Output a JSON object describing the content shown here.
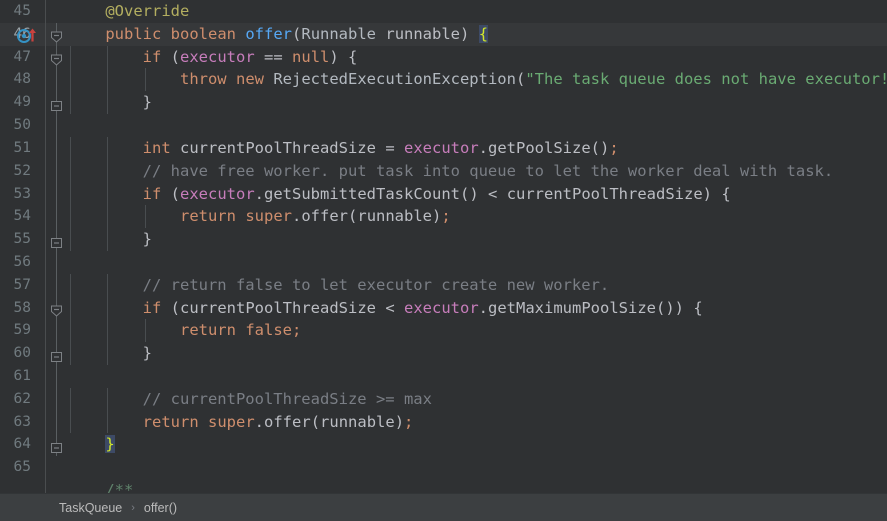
{
  "app": {
    "kind": "code-editor",
    "theme": "darcula",
    "background": "#2f3133",
    "current_line_background": "#36383a",
    "gutter_text_color": "#707a7f"
  },
  "colors": {
    "keyword": "#cf8e6d",
    "string": "#6aab73",
    "comment": "#7a7e85",
    "javadoc": "#5f826b",
    "annotation": "#b3ae60",
    "method": "#56a8f5",
    "field": "#c77dbb",
    "text": "#bcbec4",
    "brace_match_bg": "#3d4a66",
    "brace_match_fg": "#d2e82a",
    "override_marker": "#3592c4",
    "override_arrow": "#c9423f"
  },
  "gutter": {
    "line_numbers": [
      "45",
      "46",
      "47",
      "48",
      "49",
      "50",
      "51",
      "52",
      "53",
      "54",
      "55",
      "56",
      "57",
      "58",
      "59",
      "60",
      "61",
      "62",
      "63",
      "64",
      "65"
    ],
    "current_line_number": "46",
    "markers": [
      {
        "line": "46",
        "icon": "implementing-method-icon",
        "label": "Implements method"
      },
      {
        "line": "46",
        "icon": "up-arrow-icon",
        "label": "Overrides method in parent"
      }
    ]
  },
  "code": {
    "language": "Java",
    "lines": [
      {
        "num": "45",
        "current": false,
        "fold": null,
        "tokens": [
          {
            "t": "    ",
            "c": "plain"
          },
          {
            "t": "@Override",
            "c": "ann"
          }
        ]
      },
      {
        "num": "46",
        "current": true,
        "fold": "open",
        "tokens": [
          {
            "t": "    ",
            "c": "plain"
          },
          {
            "t": "public",
            "c": "k"
          },
          {
            "t": " ",
            "c": "plain"
          },
          {
            "t": "boolean",
            "c": "k"
          },
          {
            "t": " ",
            "c": "plain"
          },
          {
            "t": "offer",
            "c": "mth"
          },
          {
            "t": "(",
            "c": "pun"
          },
          {
            "t": "Runnable",
            "c": "cls"
          },
          {
            "t": " ",
            "c": "plain"
          },
          {
            "t": "runnable",
            "c": "plain"
          },
          {
            "t": ")",
            "c": "pun"
          },
          {
            "t": " ",
            "c": "plain"
          },
          {
            "t": "{",
            "c": "brace-hl"
          }
        ]
      },
      {
        "num": "47",
        "current": false,
        "fold": "open",
        "tokens": [
          {
            "t": "        ",
            "c": "plain"
          },
          {
            "t": "if",
            "c": "k"
          },
          {
            "t": " ",
            "c": "plain"
          },
          {
            "t": "(",
            "c": "pun"
          },
          {
            "t": "executor",
            "c": "fld"
          },
          {
            "t": " ",
            "c": "plain"
          },
          {
            "t": "==",
            "c": "plain"
          },
          {
            "t": " ",
            "c": "plain"
          },
          {
            "t": "null",
            "c": "k"
          },
          {
            "t": ")",
            "c": "pun"
          },
          {
            "t": " ",
            "c": "plain"
          },
          {
            "t": "{",
            "c": "pun"
          }
        ]
      },
      {
        "num": "48",
        "current": false,
        "fold": null,
        "tokens": [
          {
            "t": "            ",
            "c": "plain"
          },
          {
            "t": "throw",
            "c": "k"
          },
          {
            "t": " ",
            "c": "plain"
          },
          {
            "t": "new",
            "c": "k"
          },
          {
            "t": " ",
            "c": "plain"
          },
          {
            "t": "RejectedExecutionException",
            "c": "cls"
          },
          {
            "t": "(",
            "c": "pun"
          },
          {
            "t": "\"The task queue does not have executor!\"",
            "c": "str"
          },
          {
            "t": ")",
            "c": "pun"
          },
          {
            "t": ";",
            "c": "semi"
          }
        ]
      },
      {
        "num": "49",
        "current": false,
        "fold": "close",
        "tokens": [
          {
            "t": "        ",
            "c": "plain"
          },
          {
            "t": "}",
            "c": "pun"
          }
        ]
      },
      {
        "num": "50",
        "current": false,
        "fold": null,
        "tokens": []
      },
      {
        "num": "51",
        "current": false,
        "fold": null,
        "tokens": [
          {
            "t": "        ",
            "c": "plain"
          },
          {
            "t": "int",
            "c": "k"
          },
          {
            "t": " ",
            "c": "plain"
          },
          {
            "t": "currentPoolThreadSize",
            "c": "plain"
          },
          {
            "t": " ",
            "c": "plain"
          },
          {
            "t": "=",
            "c": "plain"
          },
          {
            "t": " ",
            "c": "plain"
          },
          {
            "t": "executor",
            "c": "fld"
          },
          {
            "t": ".",
            "c": "pun"
          },
          {
            "t": "getPoolSize",
            "c": "plain"
          },
          {
            "t": "()",
            "c": "pun"
          },
          {
            "t": ";",
            "c": "semi"
          }
        ]
      },
      {
        "num": "52",
        "current": false,
        "fold": null,
        "tokens": [
          {
            "t": "        ",
            "c": "plain"
          },
          {
            "t": "// have free worker. put task into queue to let the worker deal with task.",
            "c": "cmt"
          }
        ]
      },
      {
        "num": "53",
        "current": false,
        "fold": null,
        "tokens": [
          {
            "t": "        ",
            "c": "plain"
          },
          {
            "t": "if",
            "c": "k"
          },
          {
            "t": " ",
            "c": "plain"
          },
          {
            "t": "(",
            "c": "pun"
          },
          {
            "t": "executor",
            "c": "fld"
          },
          {
            "t": ".",
            "c": "pun"
          },
          {
            "t": "getSubmittedTaskCount",
            "c": "plain"
          },
          {
            "t": "()",
            "c": "pun"
          },
          {
            "t": " ",
            "c": "plain"
          },
          {
            "t": "<",
            "c": "plain"
          },
          {
            "t": " ",
            "c": "plain"
          },
          {
            "t": "currentPoolThreadSize",
            "c": "plain"
          },
          {
            "t": ")",
            "c": "pun"
          },
          {
            "t": " ",
            "c": "plain"
          },
          {
            "t": "{",
            "c": "pun"
          }
        ]
      },
      {
        "num": "54",
        "current": false,
        "fold": null,
        "tokens": [
          {
            "t": "            ",
            "c": "plain"
          },
          {
            "t": "return",
            "c": "k"
          },
          {
            "t": " ",
            "c": "plain"
          },
          {
            "t": "super",
            "c": "k"
          },
          {
            "t": ".",
            "c": "pun"
          },
          {
            "t": "offer",
            "c": "plain"
          },
          {
            "t": "(",
            "c": "pun"
          },
          {
            "t": "runnable",
            "c": "plain"
          },
          {
            "t": ")",
            "c": "pun"
          },
          {
            "t": ";",
            "c": "semi"
          }
        ]
      },
      {
        "num": "55",
        "current": false,
        "fold": "close",
        "tokens": [
          {
            "t": "        ",
            "c": "plain"
          },
          {
            "t": "}",
            "c": "pun"
          }
        ]
      },
      {
        "num": "56",
        "current": false,
        "fold": null,
        "tokens": []
      },
      {
        "num": "57",
        "current": false,
        "fold": null,
        "tokens": [
          {
            "t": "        ",
            "c": "plain"
          },
          {
            "t": "// return false to let executor create new worker.",
            "c": "cmt"
          }
        ]
      },
      {
        "num": "58",
        "current": false,
        "fold": "open",
        "tokens": [
          {
            "t": "        ",
            "c": "plain"
          },
          {
            "t": "if",
            "c": "k"
          },
          {
            "t": " ",
            "c": "plain"
          },
          {
            "t": "(",
            "c": "pun"
          },
          {
            "t": "currentPoolThreadSize",
            "c": "plain"
          },
          {
            "t": " ",
            "c": "plain"
          },
          {
            "t": "<",
            "c": "plain"
          },
          {
            "t": " ",
            "c": "plain"
          },
          {
            "t": "executor",
            "c": "fld"
          },
          {
            "t": ".",
            "c": "pun"
          },
          {
            "t": "getMaximumPoolSize",
            "c": "plain"
          },
          {
            "t": "())",
            "c": "pun"
          },
          {
            "t": " ",
            "c": "plain"
          },
          {
            "t": "{",
            "c": "pun"
          }
        ]
      },
      {
        "num": "59",
        "current": false,
        "fold": null,
        "tokens": [
          {
            "t": "            ",
            "c": "plain"
          },
          {
            "t": "return",
            "c": "k"
          },
          {
            "t": " ",
            "c": "plain"
          },
          {
            "t": "false",
            "c": "k"
          },
          {
            "t": ";",
            "c": "semi"
          }
        ]
      },
      {
        "num": "60",
        "current": false,
        "fold": "close",
        "tokens": [
          {
            "t": "        ",
            "c": "plain"
          },
          {
            "t": "}",
            "c": "pun"
          }
        ]
      },
      {
        "num": "61",
        "current": false,
        "fold": null,
        "tokens": []
      },
      {
        "num": "62",
        "current": false,
        "fold": null,
        "tokens": [
          {
            "t": "        ",
            "c": "plain"
          },
          {
            "t": "// currentPoolThreadSize >= max",
            "c": "cmt"
          }
        ]
      },
      {
        "num": "63",
        "current": false,
        "fold": null,
        "tokens": [
          {
            "t": "        ",
            "c": "plain"
          },
          {
            "t": "return",
            "c": "k"
          },
          {
            "t": " ",
            "c": "plain"
          },
          {
            "t": "super",
            "c": "k"
          },
          {
            "t": ".",
            "c": "pun"
          },
          {
            "t": "offer",
            "c": "plain"
          },
          {
            "t": "(",
            "c": "pun"
          },
          {
            "t": "runnable",
            "c": "plain"
          },
          {
            "t": ")",
            "c": "pun"
          },
          {
            "t": ";",
            "c": "semi"
          }
        ]
      },
      {
        "num": "64",
        "current": false,
        "fold": "close",
        "tokens": [
          {
            "t": "    ",
            "c": "plain"
          },
          {
            "t": "}",
            "c": "brace-hl"
          }
        ]
      },
      {
        "num": "65",
        "current": false,
        "fold": null,
        "tokens": []
      },
      {
        "num": "",
        "current": false,
        "fold": null,
        "tokens": [
          {
            "t": "    ",
            "c": "plain"
          },
          {
            "t": "/**",
            "c": "jdoc"
          }
        ]
      }
    ]
  },
  "breadcrumb": {
    "separator": "›",
    "items": [
      {
        "label": "TaskQueue"
      },
      {
        "label": "offer()"
      }
    ]
  }
}
